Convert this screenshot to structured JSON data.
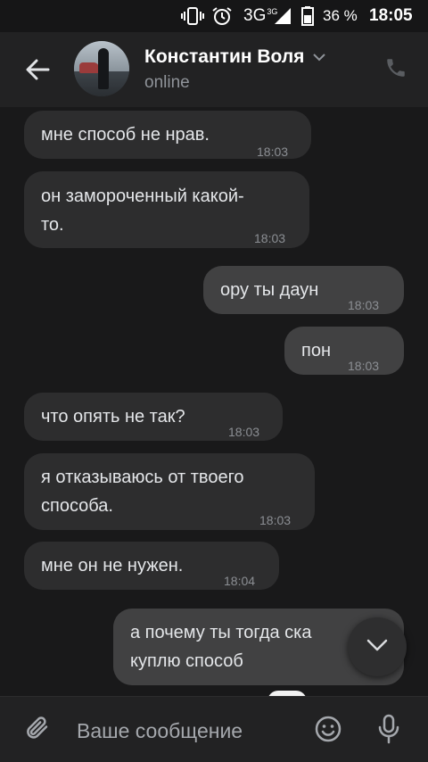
{
  "status_bar": {
    "network": "3G",
    "network_sup": "3G",
    "battery_percent": "36 %",
    "time": "18:05",
    "icons": [
      "vibrate-icon",
      "alarm-icon",
      "signal-icon",
      "battery-icon"
    ]
  },
  "header": {
    "contact_name": "Константин Воля",
    "status": "online",
    "icons": [
      "back-arrow-icon",
      "chevron-down-icon",
      "phone-icon"
    ]
  },
  "messages": [
    {
      "direction": "in",
      "lines": [
        "мне способ не нрав."
      ],
      "time": "18:03"
    },
    {
      "direction": "in",
      "lines": [
        "он замороченный какой-",
        "то."
      ],
      "time": "18:03"
    },
    {
      "direction": "out",
      "lines": [
        "ору ты даун"
      ],
      "time": "18:03"
    },
    {
      "direction": "out",
      "lines": [
        "пон"
      ],
      "time": "18:03"
    },
    {
      "direction": "in",
      "lines": [
        "что опять не так?"
      ],
      "time": "18:03"
    },
    {
      "direction": "in",
      "lines": [
        "я отказываюсь от твоего",
        "способа."
      ],
      "time": "18:03"
    },
    {
      "direction": "in",
      "lines": [
        "мне он не нужен."
      ],
      "time": "18:04"
    },
    {
      "direction": "out",
      "lines": [
        "а почему ты тогда ска",
        "куплю способ"
      ],
      "time": ""
    }
  ],
  "composer": {
    "placeholder": "Ваше сообщение",
    "icons": [
      "attach-icon",
      "emoji-icon",
      "microphone-icon"
    ]
  },
  "colors": {
    "background": "#19191a",
    "header": "#222223",
    "bubble_in": "#2d2d2e",
    "bubble_out": "#414142",
    "text": "#e4e6e9",
    "secondary_text": "#8f9399"
  }
}
